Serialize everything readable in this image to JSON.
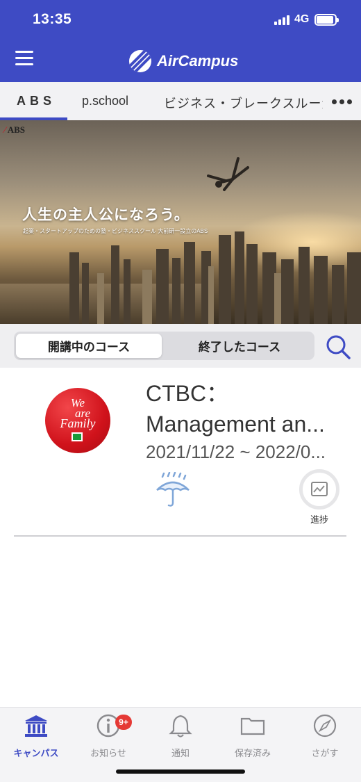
{
  "status_bar": {
    "time": "13:35",
    "network": "4G"
  },
  "app": {
    "name": "AirCampus"
  },
  "tabs": [
    {
      "label": "ABS"
    },
    {
      "label": "p.school"
    },
    {
      "label": "ビジネス・ブレークスルー大学"
    }
  ],
  "banner": {
    "brand": "ABS",
    "headline": "人生の主人公になろう。",
    "subtitle": "起業・スタートアップのための塾・ビジネススクール 大前研一設立のABS"
  },
  "segments": {
    "active": "開講中のコース",
    "inactive": "終了したコース"
  },
  "course": {
    "logo_text_1": "We",
    "logo_text_2": "are",
    "logo_text_3": "Family",
    "title_line1": "CTBC：",
    "title_line2": "Management an...",
    "dates": "2021/11/22 ~ 2022/0...",
    "progress_label": "進捗"
  },
  "bottom_nav": [
    {
      "label": "キャンパス",
      "icon": "campus-icon",
      "active": true
    },
    {
      "label": "お知らせ",
      "icon": "info-icon",
      "badge": "9+"
    },
    {
      "label": "通知",
      "icon": "bell-icon"
    },
    {
      "label": "保存済み",
      "icon": "folder-icon"
    },
    {
      "label": "さがす",
      "icon": "compass-icon"
    }
  ],
  "colors": {
    "primary": "#3e4bc4",
    "badge": "#e53935",
    "logo_red": "#d0121b"
  }
}
